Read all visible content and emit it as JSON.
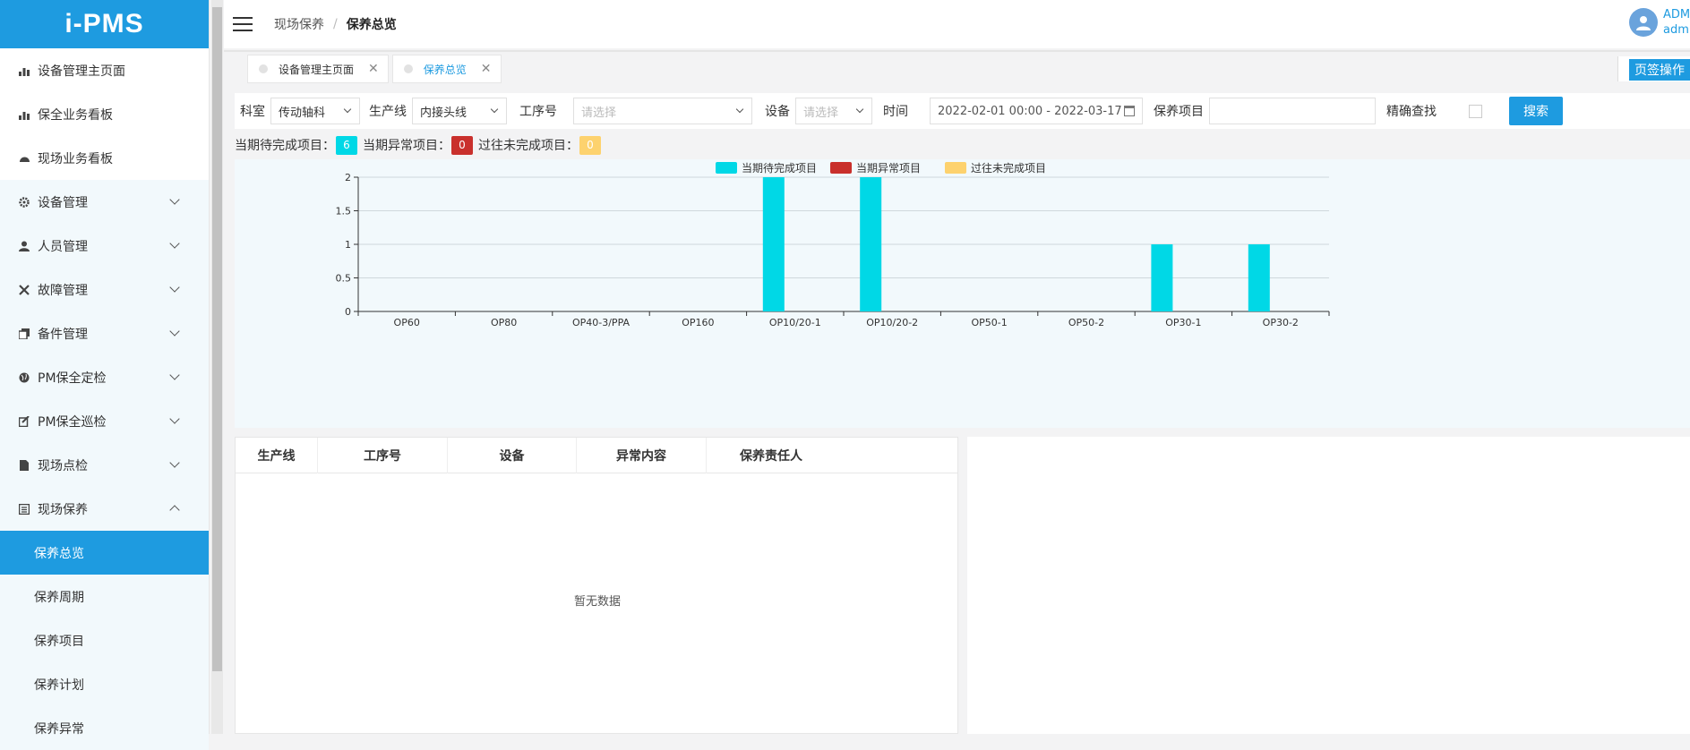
{
  "app": {
    "logo": "i-PMS"
  },
  "sidebar": {
    "items": [
      {
        "label": "设备管理主页面",
        "icon": "bar-chart-icon",
        "group": false
      },
      {
        "label": "保全业务看板",
        "icon": "bar-chart-icon",
        "group": false
      },
      {
        "label": "现场业务看板",
        "icon": "dashboard-icon",
        "group": false
      },
      {
        "label": "设备管理",
        "icon": "gear-icon",
        "group": true,
        "expanded": false
      },
      {
        "label": "人员管理",
        "icon": "user-icon",
        "group": true,
        "expanded": false
      },
      {
        "label": "故障管理",
        "icon": "tools-icon",
        "group": true,
        "expanded": false
      },
      {
        "label": "备件管理",
        "icon": "copy-icon",
        "group": true,
        "expanded": false
      },
      {
        "label": "PM保全定检",
        "icon": "globe-icon",
        "group": true,
        "expanded": false
      },
      {
        "label": "PM保全巡检",
        "icon": "edit-icon",
        "group": true,
        "expanded": false
      },
      {
        "label": "现场点检",
        "icon": "file-icon",
        "group": true,
        "expanded": false
      },
      {
        "label": "现场保养",
        "icon": "list-icon",
        "group": true,
        "expanded": true
      }
    ],
    "subitems": [
      {
        "label": "保养总览",
        "active": true
      },
      {
        "label": "保养周期",
        "active": false
      },
      {
        "label": "保养项目",
        "active": false
      },
      {
        "label": "保养计划",
        "active": false
      },
      {
        "label": "保养异常",
        "active": false
      }
    ]
  },
  "header": {
    "breadcrumb": [
      "现场保养",
      "保养总览"
    ],
    "user": {
      "name": "ADMIN",
      "account": "admin"
    }
  },
  "tabs": [
    {
      "label": "设备管理主页面",
      "active": false
    },
    {
      "label": "保养总览",
      "active": true
    }
  ],
  "page_op_label": "页签操作",
  "filters": {
    "dept_label": "科室",
    "dept_value": "传动轴科",
    "line_label": "生产线",
    "line_value": "内接头线",
    "process_label": "工序号",
    "process_placeholder": "请选择",
    "equip_label": "设备",
    "equip_placeholder": "请选择",
    "time_label": "时间",
    "time_value": "2022-02-01 00:00 - 2022-03-17",
    "item_label": "保养项目",
    "item_value": "",
    "exact_label": "精确查找",
    "search_label": "搜索"
  },
  "summary": {
    "pending_label": "当期待完成项目：",
    "pending_count": "6",
    "pending_color": "#00d8e6",
    "abnormal_label": "当期异常项目：",
    "abnormal_count": "0",
    "abnormal_color": "#c9302c",
    "overdue_label": "过往未完成项目：",
    "overdue_count": "0",
    "overdue_color": "#fdd26e"
  },
  "chart_data": {
    "type": "bar",
    "categories": [
      "OP60",
      "OP80",
      "OP40-3/PPA",
      "OP160",
      "OP10/20-1",
      "OP10/20-2",
      "OP50-1",
      "OP50-2",
      "OP30-1",
      "OP30-2"
    ],
    "series": [
      {
        "name": "当期待完成项目",
        "color": "#00d8e6",
        "values": [
          0,
          0,
          0,
          0,
          2,
          2,
          0,
          0,
          1,
          1
        ]
      },
      {
        "name": "当期异常项目",
        "color": "#c9302c",
        "values": [
          0,
          0,
          0,
          0,
          0,
          0,
          0,
          0,
          0,
          0
        ]
      },
      {
        "name": "过往未完成项目",
        "color": "#fdd26e",
        "values": [
          0,
          0,
          0,
          0,
          0,
          0,
          0,
          0,
          0,
          0
        ]
      }
    ],
    "yticks": [
      "0",
      "0.5",
      "1",
      "1.5",
      "2"
    ],
    "ylim": [
      0,
      2
    ],
    "grid": true,
    "legend": "top-center"
  },
  "table": {
    "columns": [
      "生产线",
      "工序号",
      "设备",
      "异常内容",
      "保养责任人"
    ],
    "empty_text": "暂无数据"
  }
}
